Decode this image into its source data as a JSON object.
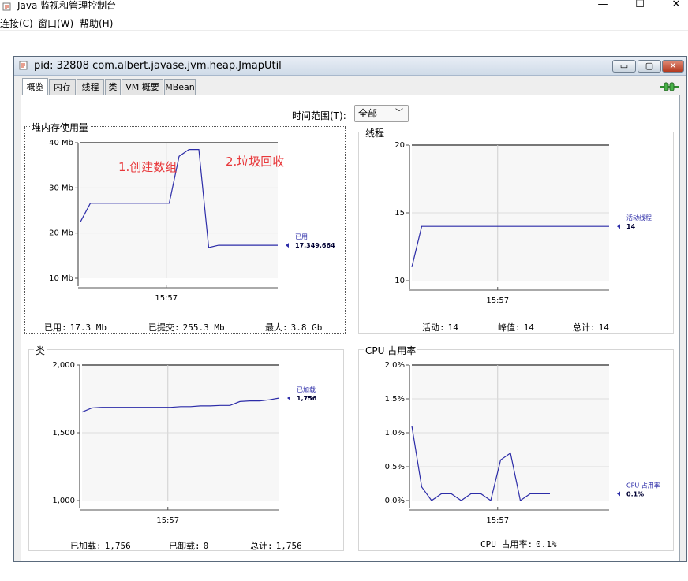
{
  "window": {
    "title": "Java 监视和管理控制台"
  },
  "menubar": {
    "items": [
      "连接(C)",
      "窗口(W)",
      "帮助(H)"
    ]
  },
  "frame": {
    "title": "pid: 32808 com.albert.javase.jvm.heap.JmapUtil"
  },
  "tabs": [
    "概览",
    "内存",
    "线程",
    "类",
    "VM 概要",
    "MBean"
  ],
  "time_range": {
    "label": "时间范围(T):",
    "value": "全部"
  },
  "colors": {
    "line": "#2c2ca8",
    "frame_border": "#5a6a7c",
    "annotation": "#e8383b"
  },
  "panels": {
    "heap": {
      "title": "堆内存使用量",
      "annotations": [
        "1.创建数组",
        "2.垃圾回收"
      ],
      "stats": {
        "used_label": "已用:",
        "used": "17.3 Mb",
        "committed_label": "已提交:",
        "committed": "255.3 Mb",
        "max_label": "最大:",
        "max": "3.8 Gb"
      }
    },
    "threads": {
      "title": "线程",
      "stats": {
        "live_label": "活动:",
        "live": "14",
        "peak_label": "峰值:",
        "peak": "14",
        "total_label": "总计:",
        "total": "14"
      }
    },
    "classes": {
      "title": "类",
      "stats": {
        "loaded_label": "已加载:",
        "loaded": "1,756",
        "unloaded_label": "已卸载:",
        "unloaded": "0",
        "total_label": "总计:",
        "total": "1,756"
      }
    },
    "cpu": {
      "title": "CPU 占用率",
      "stats": {
        "label": "CPU 占用率:",
        "value": "0.1%"
      }
    }
  },
  "chart_data": [
    {
      "type": "line",
      "id": "heap",
      "ylim": [
        10,
        40
      ],
      "yticks": [
        "10 Mb",
        "20 Mb",
        "30 Mb",
        "40 Mb"
      ],
      "ytick_values": [
        10,
        20,
        30,
        40
      ],
      "xtick": "15:57",
      "x": [
        0,
        1,
        2,
        3,
        4,
        5,
        6,
        7,
        8,
        9,
        10,
        11,
        12,
        13,
        14,
        15,
        16,
        17,
        18,
        19,
        20
      ],
      "series": [
        {
          "name": "已用",
          "values": [
            22.5,
            26.6,
            26.6,
            26.6,
            26.6,
            26.6,
            26.6,
            26.6,
            26.6,
            26.6,
            37,
            38.5,
            38.5,
            16.8,
            17.3,
            17.3,
            17.3,
            17.3,
            17.3,
            17.3,
            17.3
          ]
        }
      ],
      "marker_label": "已用",
      "marker_value": "17,349,664"
    },
    {
      "type": "line",
      "id": "threads",
      "ylim": [
        10,
        20
      ],
      "yticks": [
        "10",
        "15",
        "20"
      ],
      "ytick_values": [
        10,
        15,
        20
      ],
      "xtick": "15:57",
      "x": [
        0,
        1,
        2,
        3,
        4,
        5,
        6,
        7,
        8,
        9,
        10,
        11,
        12,
        13,
        14,
        15,
        16,
        17,
        18,
        19,
        20
      ],
      "series": [
        {
          "name": "活动线程",
          "values": [
            11,
            14,
            14,
            14,
            14,
            14,
            14,
            14,
            14,
            14,
            14,
            14,
            14,
            14,
            14,
            14,
            14,
            14,
            14,
            14,
            14
          ]
        }
      ],
      "marker_label": "活动线程",
      "marker_value": "14"
    },
    {
      "type": "line",
      "id": "classes",
      "ylim": [
        1000,
        2000
      ],
      "yticks": [
        "1,000",
        "1,500",
        "2,000"
      ],
      "ytick_values": [
        1000,
        1500,
        2000
      ],
      "xtick": "15:57",
      "x": [
        0,
        1,
        2,
        3,
        4,
        5,
        6,
        7,
        8,
        9,
        10,
        11,
        12,
        13,
        14,
        15,
        16,
        17,
        18,
        19,
        20
      ],
      "series": [
        {
          "name": "已加载",
          "values": [
            1653,
            1683,
            1688,
            1688,
            1688,
            1688,
            1688,
            1688,
            1688,
            1688,
            1693,
            1693,
            1698,
            1698,
            1702,
            1702,
            1730,
            1735,
            1735,
            1743,
            1756
          ]
        }
      ],
      "marker_label": "已加载",
      "marker_value": "1,756"
    },
    {
      "type": "line",
      "id": "cpu",
      "ylim": [
        0,
        2
      ],
      "yticks": [
        "0.0%",
        "0.5%",
        "1.0%",
        "1.5%",
        "2.0%"
      ],
      "ytick_values": [
        0,
        0.5,
        1,
        1.5,
        2
      ],
      "xtick": "15:57",
      "x": [
        0,
        1,
        2,
        3,
        4,
        5,
        6,
        7,
        8,
        9,
        10,
        11,
        12,
        13,
        14,
        15,
        16,
        17,
        18,
        19,
        20
      ],
      "series": [
        {
          "name": "CPU 占用率",
          "values": [
            1.1,
            0.2,
            0,
            0.1,
            0.1,
            0,
            0.1,
            0.1,
            0,
            0.6,
            0.7,
            0,
            0.1,
            0.1,
            0.1
          ]
        }
      ],
      "marker_label": "CPU 占用率",
      "marker_value": "0.1%"
    }
  ]
}
